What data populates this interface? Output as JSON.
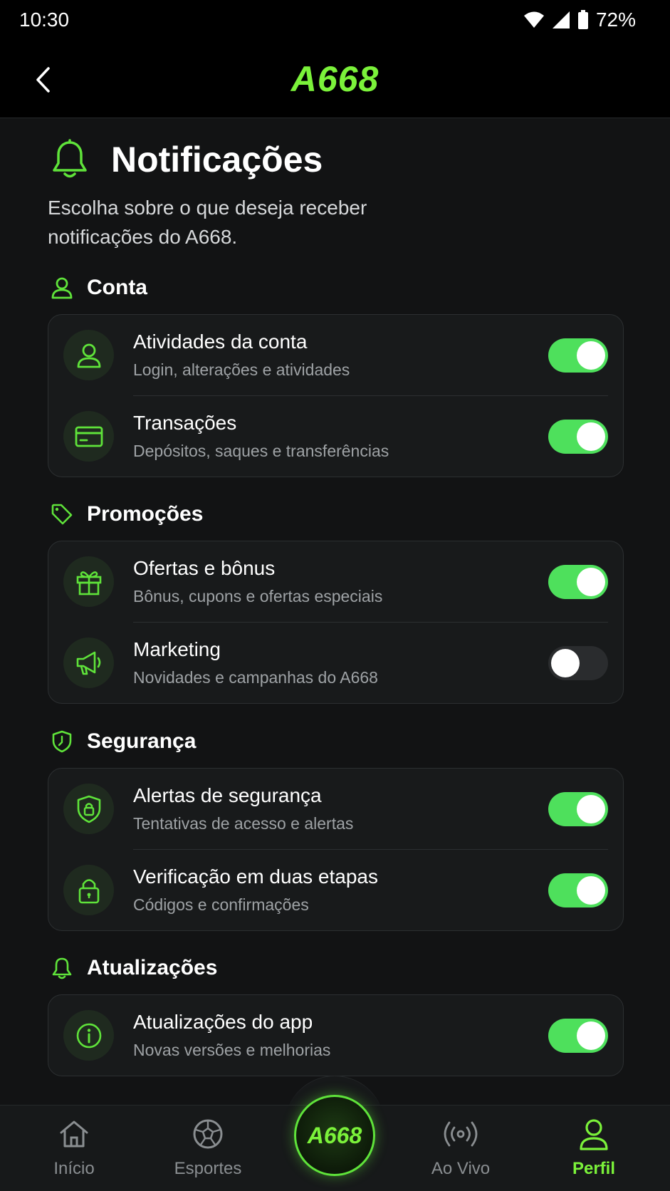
{
  "status_bar": {
    "time": "10:30",
    "battery": "72%"
  },
  "header": {
    "logo": "A668"
  },
  "page": {
    "title": "Notificações",
    "description": "Escolha sobre o que deseja receber notificações do A668."
  },
  "sections": [
    {
      "title": "Conta",
      "icon": "user-icon",
      "items": [
        {
          "title": "Atividades da conta",
          "subtitle": "Login, alterações e atividades",
          "icon": "user-icon",
          "enabled": true
        },
        {
          "title": "Transações",
          "subtitle": "Depósitos, saques e transferências",
          "icon": "card-icon",
          "enabled": true
        }
      ]
    },
    {
      "title": "Promoções",
      "icon": "tag-icon",
      "items": [
        {
          "title": "Ofertas e bônus",
          "subtitle": "Bônus, cupons e ofertas especiais",
          "icon": "gift-icon",
          "enabled": true
        },
        {
          "title": "Marketing",
          "subtitle": "Novidades e campanhas do A668",
          "icon": "megaphone-icon",
          "enabled": false
        }
      ]
    },
    {
      "title": "Segurança",
      "icon": "shield-icon",
      "items": [
        {
          "title": "Alertas de segurança",
          "subtitle": "Tentativas de acesso e alertas",
          "icon": "shield-lock-icon",
          "enabled": true
        },
        {
          "title": "Verificação em duas etapas",
          "subtitle": "Códigos e confirmações",
          "icon": "lock-icon",
          "enabled": true
        }
      ]
    },
    {
      "title": "Atualizações",
      "icon": "bell-icon",
      "items": [
        {
          "title": "Atualizações do app",
          "subtitle": "Novas versões e melhorias",
          "icon": "info-icon",
          "enabled": true
        }
      ]
    }
  ],
  "bottom_nav": {
    "items": [
      {
        "label": "Início",
        "icon": "home-icon",
        "active": false
      },
      {
        "label": "Esportes",
        "icon": "ball-icon",
        "active": false
      },
      {
        "label": "Ao Vivo",
        "icon": "live-icon",
        "active": false
      },
      {
        "label": "Perfil",
        "icon": "profile-icon",
        "active": true
      }
    ],
    "center_logo": "A668"
  },
  "colors": {
    "accent": "#7bf23a",
    "toggle_on": "#4ee05c",
    "background": "#121314",
    "card": "#181a1b"
  }
}
